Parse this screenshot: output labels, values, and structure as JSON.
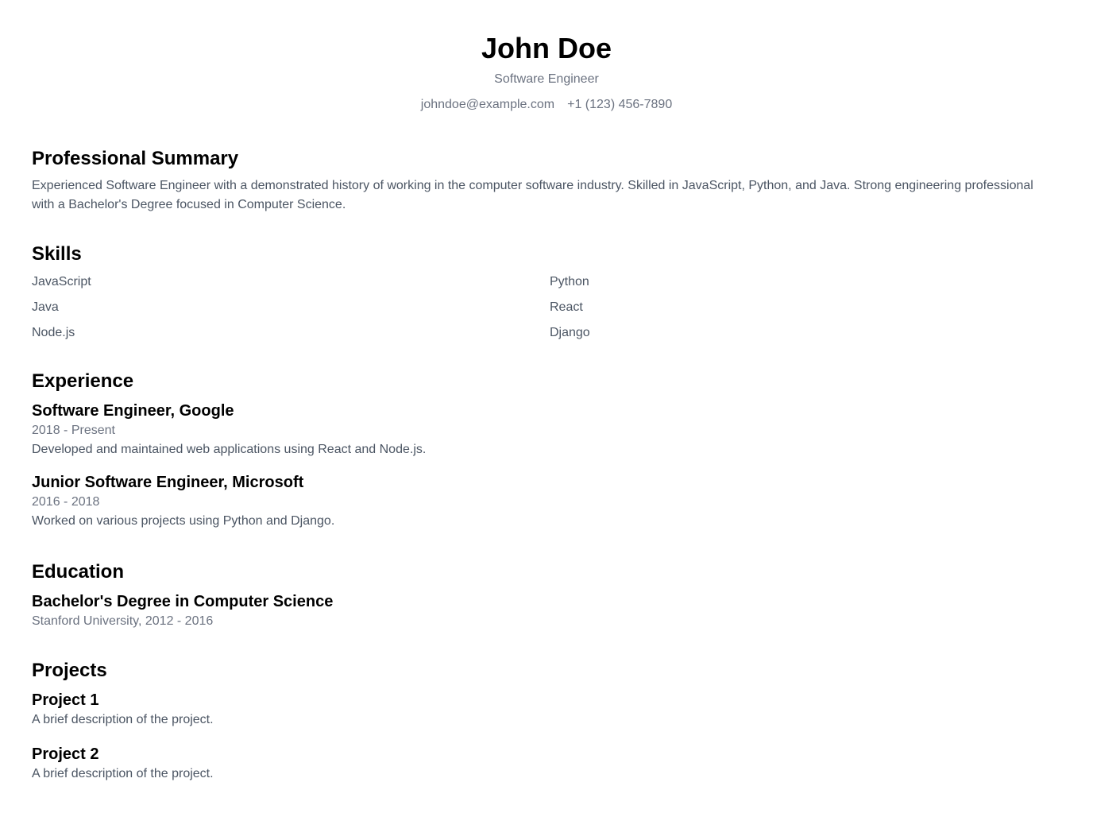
{
  "header": {
    "name": "John Doe",
    "title": "Software Engineer",
    "email": "johndoe@example.com",
    "phone": "+1 (123) 456-7890"
  },
  "summary": {
    "heading": "Professional Summary",
    "text": "Experienced Software Engineer with a demonstrated history of working in the computer software industry. Skilled in JavaScript, Python, and Java. Strong engineering professional with a Bachelor's Degree focused in Computer Science."
  },
  "skills": {
    "heading": "Skills",
    "items": [
      "JavaScript",
      "Python",
      "Java",
      "React",
      "Node.js",
      "Django"
    ]
  },
  "experience": {
    "heading": "Experience",
    "items": [
      {
        "title": "Software Engineer, Google",
        "dates": "2018 - Present",
        "description": "Developed and maintained web applications using React and Node.js."
      },
      {
        "title": "Junior Software Engineer, Microsoft",
        "dates": "2016 - 2018",
        "description": "Worked on various projects using Python and Django."
      }
    ]
  },
  "education": {
    "heading": "Education",
    "items": [
      {
        "degree": "Bachelor's Degree in Computer Science",
        "detail": "Stanford University, 2012 - 2016"
      }
    ]
  },
  "projects": {
    "heading": "Projects",
    "items": [
      {
        "title": "Project 1",
        "description": "A brief description of the project."
      },
      {
        "title": "Project 2",
        "description": "A brief description of the project."
      }
    ]
  }
}
